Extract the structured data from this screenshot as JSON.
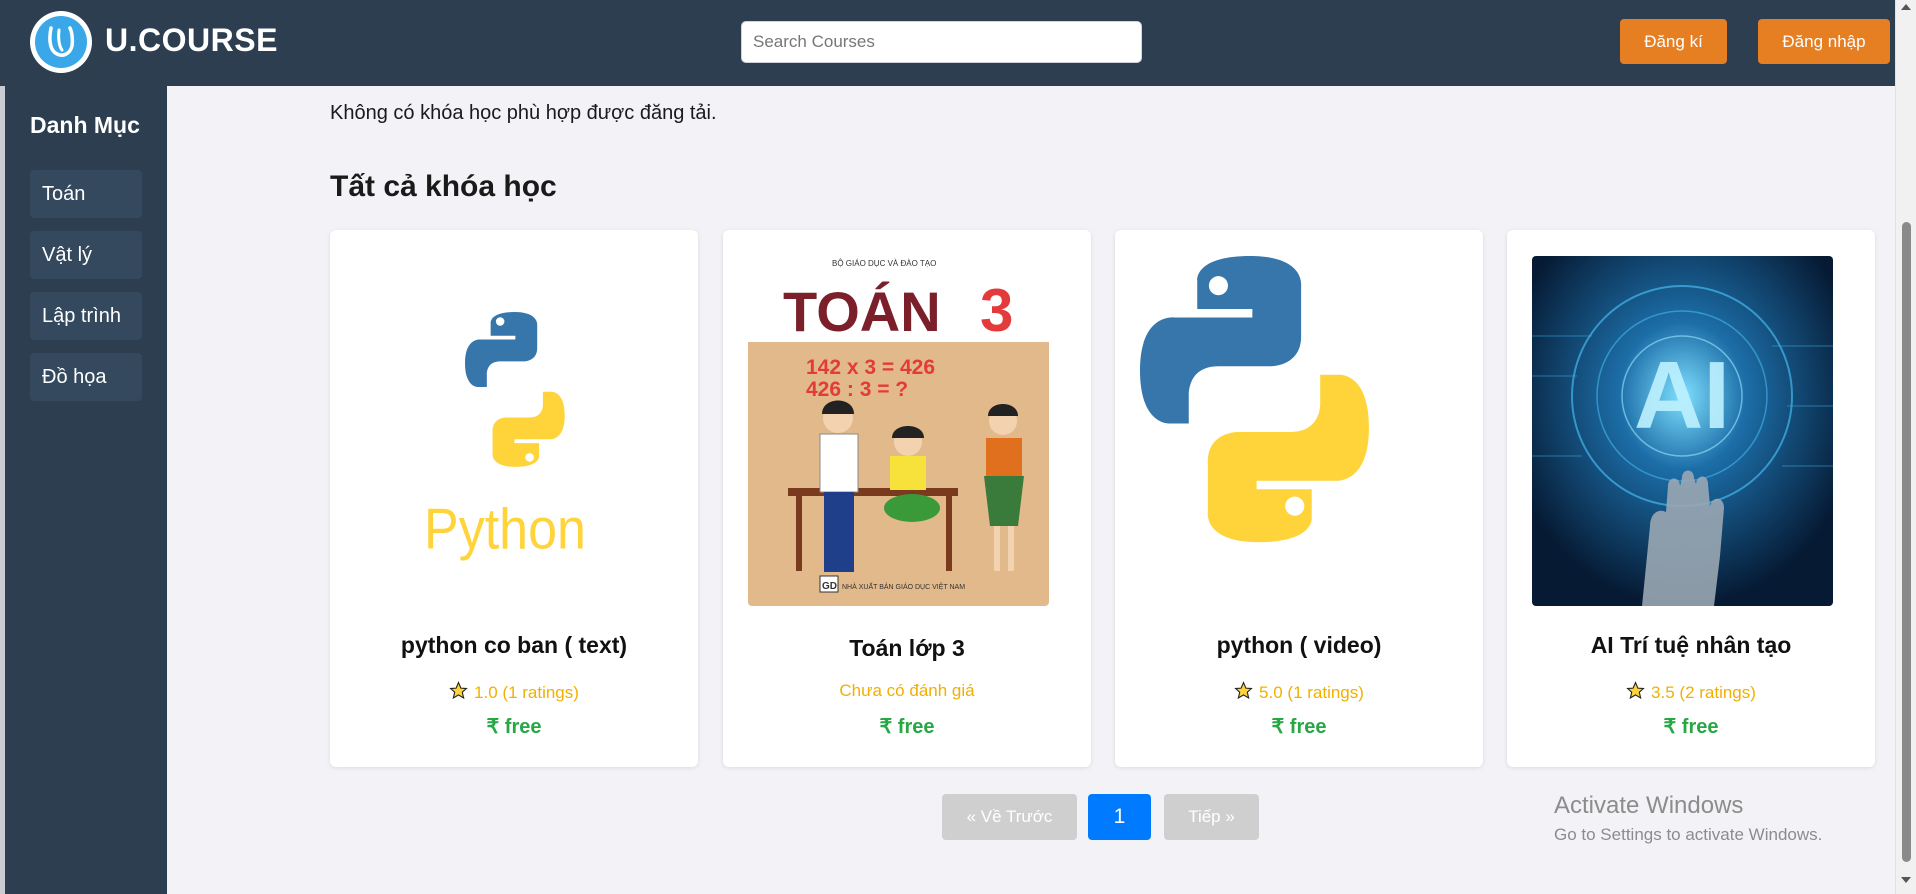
{
  "header": {
    "brand": "U.COURSE",
    "search_placeholder": "Search Courses",
    "register_label": "Đăng kí",
    "login_label": "Đăng nhập"
  },
  "sidebar": {
    "title": "Danh Mục",
    "items": [
      {
        "label": "Toán"
      },
      {
        "label": "Vật lý"
      },
      {
        "label": "Lập trình"
      },
      {
        "label": "Đồ họa"
      }
    ]
  },
  "main": {
    "notice": "Không có khóa học phù hợp được đăng tải.",
    "section_title": "Tất cả khóa học",
    "courses": [
      {
        "title": "python co ban ( text)",
        "rating_text": "1.0 (1 ratings)",
        "has_rating": true,
        "price": "₹ free",
        "image": "python-logo-with-text"
      },
      {
        "title": "Toán lớp 3",
        "rating_text": "Chưa có đánh giá",
        "has_rating": false,
        "price": "₹ free",
        "image": "math-grade-3-textbook-cover",
        "cover": {
          "publisher_top": "BỘ GIÁO DỤC VÀ ĐÀO TẠO",
          "title": "TOÁN",
          "grade": "3",
          "eq1": "142 x 3 = 426",
          "eq2": "426 : 3 = ?",
          "publisher_bottom": "NHÀ XUẤT BẢN GIÁO DỤC VIỆT NAM",
          "logo": "GD"
        }
      },
      {
        "title": "python ( video)",
        "rating_text": "5.0 (1 ratings)",
        "has_rating": true,
        "price": "₹ free",
        "image": "python-logo-large"
      },
      {
        "title": "AI Trí tuệ nhân tạo",
        "rating_text": "3.5 (2 ratings)",
        "has_rating": true,
        "price": "₹ free",
        "image": "ai-hand-hologram",
        "image_text": "AI"
      }
    ]
  },
  "pagination": {
    "prev_label": "« Về Trước",
    "current": "1",
    "next_label": "Tiếp »"
  },
  "watermark": {
    "line1": "Activate Windows",
    "line2": "Go to Settings to activate Windows."
  },
  "colors": {
    "header_bg": "#2c3e50",
    "accent_orange": "#e67e22",
    "price_green": "#28a745",
    "rating_gold": "#f1b000",
    "page_active": "#007bff",
    "python_blue": "#3776ab",
    "python_yellow": "#ffd43b"
  }
}
